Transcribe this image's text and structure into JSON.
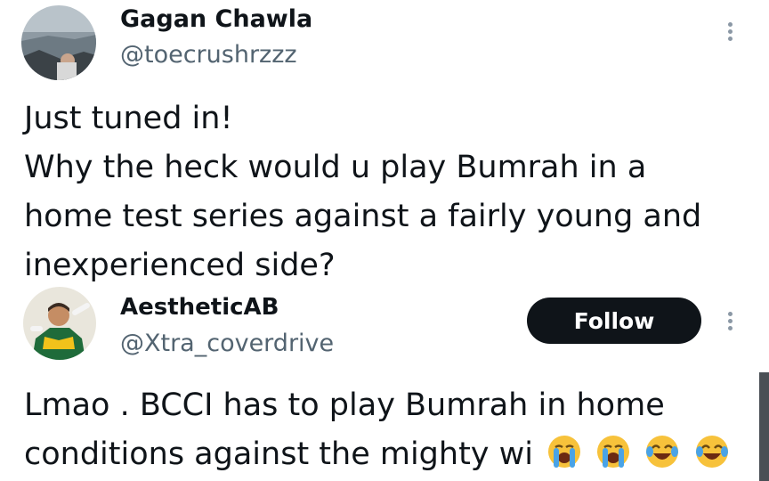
{
  "original_tweet": {
    "author_name": "Gagan Chawla",
    "author_handle": "@toecrushrzzz",
    "avatar_icon": "landscape-photo-avatar",
    "lines": [
      "Just tuned in!",
      "Why the heck would u play Bumrah in a",
      "home test series against a fairly young and",
      "inexperienced side?"
    ]
  },
  "reply_tweet": {
    "author_name": "AestheticAB",
    "author_handle": "@Xtra_coverdrive",
    "avatar_icon": "cricketer-photo-avatar",
    "follow_label": "Follow",
    "line1": "Lmao . BCCI has to play Bumrah in home",
    "line2": "conditions against the mighty wi",
    "emojis": [
      "loudly-crying-face",
      "loudly-crying-face",
      "face-with-tears-of-joy",
      "face-with-tears-of-joy"
    ]
  },
  "colors": {
    "text_primary": "#0f1419",
    "text_secondary": "#536471",
    "follow_button_bg": "#0f1419",
    "emoji_yellow": "#f7c23b",
    "tear_blue": "#4aa3e6"
  }
}
